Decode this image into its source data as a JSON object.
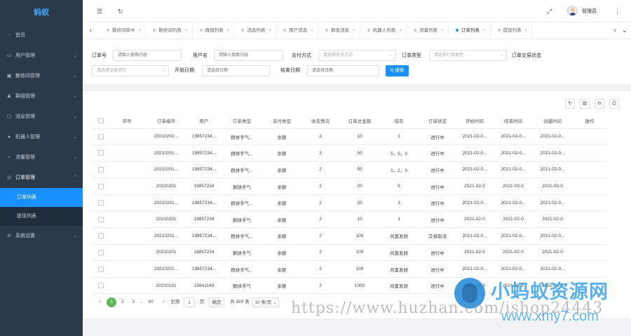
{
  "sidebar": {
    "brand": "蚂蚁",
    "items": [
      {
        "label": "首页",
        "icon": "◔"
      },
      {
        "label": "用户管理",
        "icon": "▭",
        "arrow": "⌄"
      },
      {
        "label": "散修间管理",
        "icon": "▣",
        "arrow": "⌄"
      },
      {
        "label": "群组管理",
        "icon": "♟",
        "arrow": "⌄"
      },
      {
        "label": "消息管理",
        "icon": "▢",
        "arrow": "⌄"
      },
      {
        "label": "机器人管理",
        "icon": "●",
        "arrow": "⌄"
      },
      {
        "label": "流量管理",
        "icon": "⌁",
        "arrow": "⌄"
      },
      {
        "label": "订单管理",
        "icon": "◎",
        "arrow": "⌃"
      }
    ],
    "sub_items": [
      {
        "label": "订单列表"
      },
      {
        "label": "提现列表"
      }
    ],
    "settings": {
      "label": "系统设置",
      "icon": "⊘",
      "arrow": "⌄"
    }
  },
  "header": {
    "menu_icon": "☰",
    "refresh_icon": "↻",
    "fullscreen_icon": "⤢",
    "admin_name": "管理员",
    "more_icon": "⋮"
  },
  "tabs": {
    "prev": "‹",
    "next": "›",
    "close_all": "⌄",
    "items": [
      {
        "label": "散修间审中",
        "active": false
      },
      {
        "label": "散修间列表",
        "active": false
      },
      {
        "label": "群组列表",
        "active": false
      },
      {
        "label": "消息列表",
        "active": false
      },
      {
        "label": "用户消息",
        "active": false
      },
      {
        "label": "群发消息",
        "active": false
      },
      {
        "label": "机器人列表",
        "active": false
      },
      {
        "label": "流量列表",
        "active": false
      },
      {
        "label": "订单列表",
        "active": true
      },
      {
        "label": "提现列表",
        "active": false
      }
    ]
  },
  "filters": {
    "order_no_label": "订单号",
    "order_no_placeholder": "请输入搜索内容",
    "user_label": "用户名",
    "user_placeholder": "请输入搜索内容",
    "pay_label": "支付方式",
    "pay_placeholder": "请选择支付方式",
    "type_label": "订单类型",
    "type_placeholder": "请选择订单类型",
    "status_label": "订单交易状态",
    "status_placeholder": "请选择交易状态",
    "start_label": "开始日期",
    "start_placeholder": "请选择日期",
    "end_label": "结束日期",
    "end_placeholder": "请选择日期",
    "search_label": "Q 搜索"
  },
  "toolbar": {
    "refresh": "↻",
    "columns": "▥",
    "export": "⊖",
    "print": "⎙"
  },
  "table": {
    "columns": [
      "序号",
      "订单编号",
      "用户",
      "订单类型",
      "支付类型",
      "收支情况",
      "订单总金额",
      "借有",
      "订单状态",
      "开始时间",
      "结束时间",
      "创建时间",
      "操作"
    ],
    "rows": [
      [
        "",
        "20210202...",
        "19857234...",
        "群拼手气...",
        "余额",
        "2",
        "10",
        "1",
        "进行中",
        "2021-02-0...",
        "2021-02-0...",
        "2021-02-0...",
        ""
      ],
      [
        "",
        "20210201...",
        "19857234...",
        "群拼手气...",
        "余额",
        "2",
        "50",
        "5，5，3",
        "进行中",
        "2021-02-0...",
        "2021-02-0...",
        "2021-02-0...",
        ""
      ],
      [
        "",
        "20210201...",
        "19857234...",
        "群拼手气...",
        "余额",
        "2",
        "50",
        "1，2，3",
        "进行中",
        "2021-02-0...",
        "2021-02-0...",
        "2021-02-0...",
        ""
      ],
      [
        "",
        "20210201",
        "19857234",
        "群拼手气",
        "余额",
        "2",
        "20",
        "5",
        "进行中",
        "2021-02-0",
        "2021-02-0",
        "2021-02-0",
        ""
      ],
      [
        "",
        "20210201...",
        "19857234...",
        "群拼手气...",
        "余额",
        "2",
        "20",
        "3",
        "进行中",
        "2021-02-0...",
        "2021-02-0...",
        "2021-02-0...",
        ""
      ],
      [
        "",
        "20210201",
        "19857234",
        "群拼手气",
        "余额",
        "2",
        "10",
        "1",
        "进行中",
        "2021-02-0",
        "2021-02-0",
        "2021-02-0",
        ""
      ],
      [
        "",
        "20210201...",
        "19857234...",
        "群拼手气...",
        "余额",
        "2",
        "100",
        "共富发财",
        "交易取消",
        "2021-02-0...",
        "2021-02-0...",
        "2021-02-0...",
        ""
      ],
      [
        "",
        "20210201",
        "19857234",
        "群拼手气",
        "余额",
        "2",
        "100",
        "共富发财",
        "进行中",
        "2021-02-0",
        "2021-02-0",
        "2021-02-0",
        ""
      ],
      [
        "",
        "20210201...",
        "19857234...",
        "群拼手气...",
        "余额",
        "2",
        "100",
        "共富发财",
        "进行中",
        "2021-02-0...",
        "2021-02-0...",
        "2021-02-0...",
        ""
      ],
      [
        "",
        "20210131",
        "15641143",
        "群拼手气",
        "余额",
        "2",
        "1000",
        "共富发财",
        "进行中",
        "2021-01-3",
        "2021-01-3",
        "2021-01-3",
        ""
      ]
    ]
  },
  "pagination": {
    "prev": "‹",
    "pages": [
      "1",
      "2",
      "3",
      "...",
      "80"
    ],
    "next": "›",
    "goto_label": "到第",
    "goto_value": "1",
    "page_unit": "页",
    "confirm": "确定",
    "total": "共 883 条",
    "page_size": "10 条/页 ⌄"
  },
  "watermark": {
    "cn": "小蚂蚁资源网",
    "url": "https://www.huzhan.com/ishop24443",
    "url2": "www.xmy7.com"
  }
}
